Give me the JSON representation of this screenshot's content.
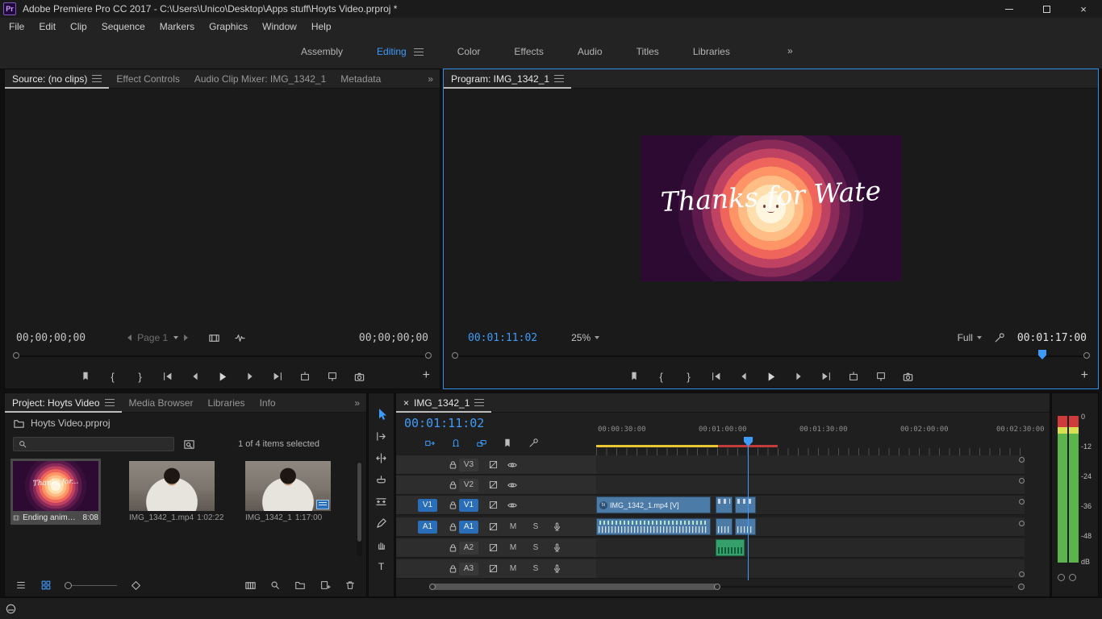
{
  "titlebar": {
    "icon": "Pr",
    "title": "Adobe Premiere Pro CC 2017 - C:\\Users\\Unico\\Desktop\\Apps stuff\\Hoyts Video.prproj *",
    "close": "×"
  },
  "menu": {
    "items": [
      "File",
      "Edit",
      "Clip",
      "Sequence",
      "Markers",
      "Graphics",
      "Window",
      "Help"
    ]
  },
  "workspaces": {
    "items": [
      "Assembly",
      "Editing",
      "Color",
      "Effects",
      "Audio",
      "Titles",
      "Libraries"
    ],
    "active": "Editing",
    "overflow": "»"
  },
  "transport": {
    "mark_in": "{",
    "mark_out": "}",
    "add": "+"
  },
  "source": {
    "tabs": [
      "Source: (no clips)",
      "Effect Controls",
      "Audio Clip Mixer: IMG_1342_1",
      "Metadata"
    ],
    "overflow": "»",
    "timecode_left": "00;00;00;00",
    "page_label": "Page 1",
    "timecode_right": "00;00;00;00"
  },
  "program": {
    "tab": "Program: IMG_1342_1",
    "preview_title": "Thanks for Wate",
    "timecode_current": "00:01:11:02",
    "zoom": "25%",
    "quality": "Full",
    "timecode_total": "00:01:17:00"
  },
  "project": {
    "tabs": [
      "Project: Hoyts Video",
      "Media Browser",
      "Libraries",
      "Info"
    ],
    "overflow": "»",
    "file_name": "Hoyts Video.prproj",
    "selection": "1 of 4 items selected",
    "items": [
      {
        "name": "Ending animation in...",
        "duration": "8:08",
        "thumb_text": "Thanks for..."
      },
      {
        "name": "IMG_1342_1.mp4",
        "duration": "1:02:22"
      },
      {
        "name": "IMG_1342_1",
        "duration": "1:17:00"
      }
    ]
  },
  "tools": {
    "type_label": "T"
  },
  "timeline": {
    "close": "×",
    "tab": "IMG_1342_1",
    "timecode": "00:01:11:02",
    "ruler": [
      "00:00:30:00",
      "00:01:00:00",
      "00:01:30:00",
      "00:02:00:00",
      "00:02:30:00"
    ],
    "video_tracks": [
      {
        "id": "V3"
      },
      {
        "id": "V2"
      },
      {
        "id": "V1",
        "patch": "V1"
      }
    ],
    "audio_tracks": [
      {
        "id": "A1",
        "patch": "A1"
      },
      {
        "id": "A2"
      },
      {
        "id": "A3"
      }
    ],
    "mute": "M",
    "solo": "S",
    "v1_clip": "IMG_1342_1.mp4 [V]",
    "fx": "fx"
  },
  "meters": {
    "scale": [
      "0",
      "-12",
      "-24",
      "-36",
      "-48"
    ],
    "unit": "dB"
  }
}
